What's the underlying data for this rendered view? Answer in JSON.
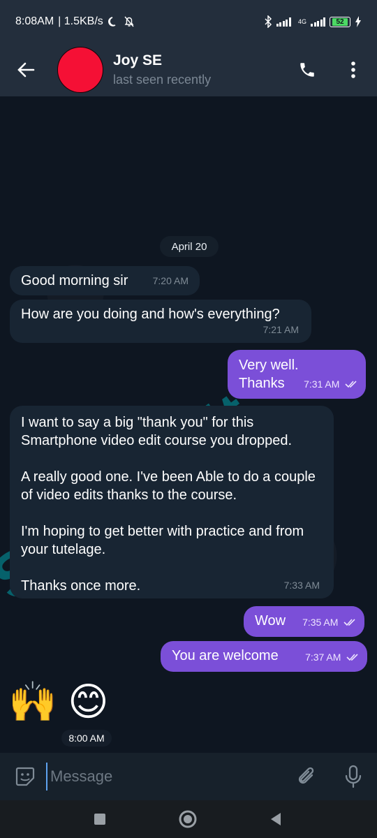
{
  "status": {
    "time": "8:08AM",
    "speed": "| 1.5KB/s",
    "network": "4G",
    "battery": "52"
  },
  "header": {
    "name": "Joy SE",
    "status": "last seen recently"
  },
  "chat": {
    "date": "April 20",
    "messages": [
      {
        "text": "Good morning sir",
        "time": "7:20 AM"
      },
      {
        "text": "How are you doing and how's everything?",
        "time": "7:21 AM"
      },
      {
        "line1": "Very well.",
        "line2": "Thanks",
        "time": "7:31 AM"
      },
      {
        "p1": "I want to say a big \"thank you\" for this Smartphone video edit course you dropped.",
        "p2": "A really good one. I've been Able to do a couple of video edits thanks to the course.",
        "p3": "I'm hoping to get better with practice and from your tutelage.",
        "p4": "Thanks once more.",
        "time": "7:33 AM"
      },
      {
        "text": "Wow",
        "time": "7:35 AM"
      },
      {
        "text": "You are welcome",
        "time": "7:37 AM"
      },
      {
        "emoji": "🙌 😊",
        "time": "8:00 AM"
      }
    ],
    "watermark": "SmartEdit"
  },
  "input": {
    "placeholder": "Message"
  },
  "colors": {
    "outgoing": "#7b4fd8",
    "incoming": "#182533",
    "header": "#232e3c",
    "avatar": "#f51035"
  }
}
